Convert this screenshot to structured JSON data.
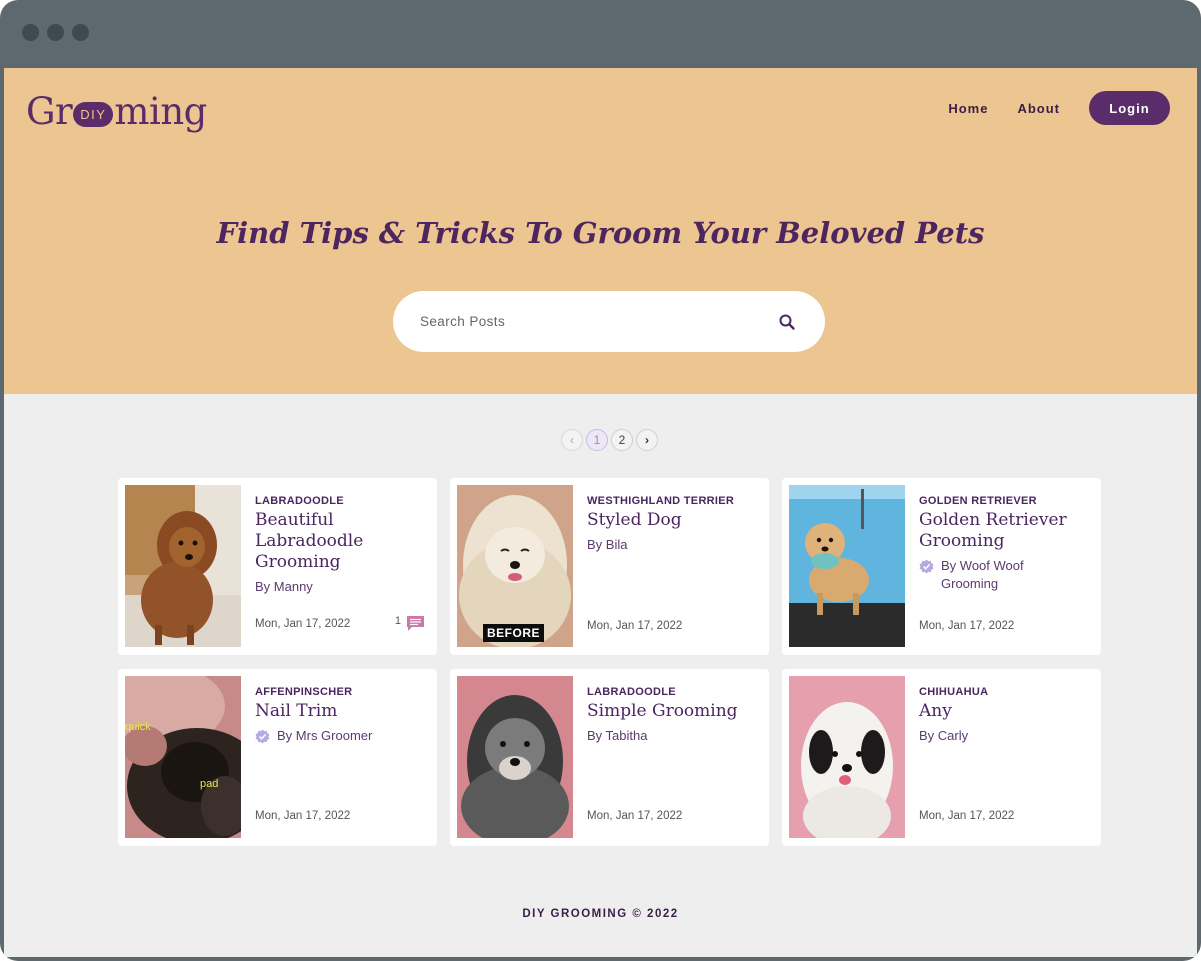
{
  "header": {
    "logo": {
      "part1": "Gr",
      "badge": "DIY",
      "part2": "ming"
    },
    "nav": {
      "home": "Home",
      "about": "About",
      "login": "Login"
    }
  },
  "hero": {
    "headline": "Find Tips & Tricks To Groom Your Beloved Pets",
    "search_placeholder": "Search Posts"
  },
  "pagination": {
    "prev": "‹",
    "pages": [
      "1",
      "2"
    ],
    "current": "1",
    "next": "›"
  },
  "posts": [
    {
      "category": "LABRADOODLE",
      "title": "Beautiful Labradoodle Grooming",
      "author": "By Manny",
      "verified": false,
      "date": "Mon, Jan 17, 2022",
      "comments": "1"
    },
    {
      "category": "WESTHIGHLAND TERRIER",
      "title": "Styled Dog",
      "author": "By Bila",
      "verified": false,
      "date": "Mon, Jan 17, 2022",
      "photo_label": "BEFORE"
    },
    {
      "category": "GOLDEN RETRIEVER",
      "title": "Golden Retriever Grooming",
      "author": "By Woof Woof Grooming",
      "verified": true,
      "date": "Mon, Jan 17, 2022"
    },
    {
      "category": "AFFENPINSCHER",
      "title": "Nail Trim",
      "author": "By Mrs Groomer",
      "verified": true,
      "date": "Mon, Jan 17, 2022",
      "photo_labels": [
        "quick",
        "pad"
      ]
    },
    {
      "category": "LABRADOODLE",
      "title": "Simple Grooming",
      "author": "By Tabitha",
      "verified": false,
      "date": "Mon, Jan 17, 2022"
    },
    {
      "category": "CHIHUAHUA",
      "title": "Any",
      "author": "By Carly",
      "verified": false,
      "date": "Mon, Jan 17, 2022"
    }
  ],
  "footer": {
    "text": "DIY GROOMING © 2022"
  },
  "colors": {
    "hero_bg": "#ecc591",
    "brand_purple": "#5a2c69",
    "page_bg": "#eeeeee",
    "browser_frame": "#5d696e"
  }
}
